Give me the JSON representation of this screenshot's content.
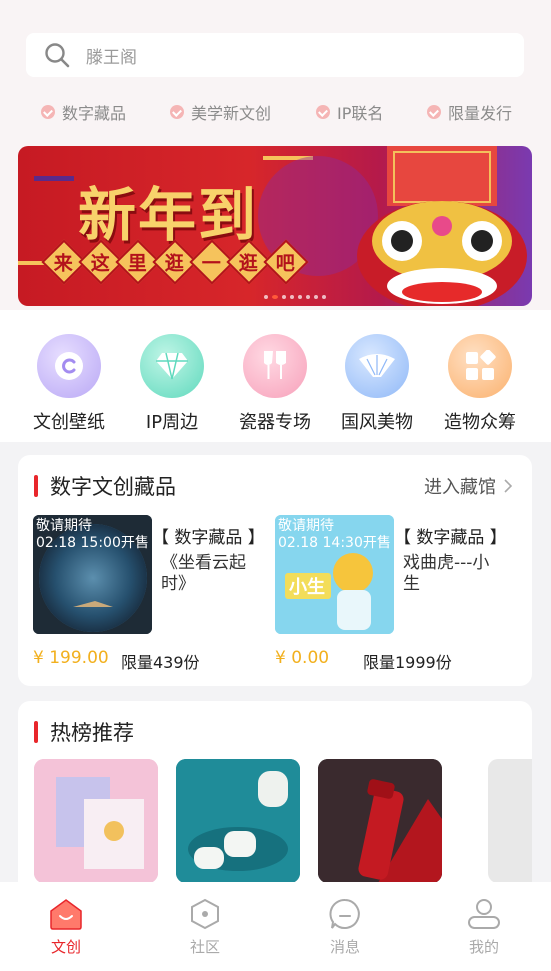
{
  "search": {
    "placeholder": "滕王阁"
  },
  "tags": [
    "数字藏品",
    "美学新文创",
    "IP联名",
    "限量发行"
  ],
  "banner": {
    "title": "新年到",
    "subtitle": [
      "来",
      "这",
      "里",
      "逛",
      "一",
      "逛",
      "吧"
    ],
    "slide_count": 8,
    "active_slide": 2
  },
  "categories": [
    {
      "label": "文创壁纸",
      "icon": "copyright-icon",
      "color": "#b9a8f5"
    },
    {
      "label": "IP周边",
      "icon": "diamond-icon",
      "color": "#5fd9bd"
    },
    {
      "label": "瓷器专场",
      "icon": "wine-glass-icon",
      "color": "#f7a0ba"
    },
    {
      "label": "国风美物",
      "icon": "fan-icon",
      "color": "#8fb8f7"
    },
    {
      "label": "造物众筹",
      "icon": "blocks-icon",
      "color": "#fbb16d"
    }
  ],
  "collection": {
    "title": "数字文创藏品",
    "more": "进入藏馆",
    "items": [
      {
        "badge1": "敬请期待",
        "badge2": "02.18 15:00开售",
        "tag": "【 数字藏品 】",
        "name": "《坐看云起时》",
        "price": "¥ 199.00",
        "limit": "限量439份"
      },
      {
        "badge1": "敬请期待",
        "badge2": "02.18 14:30开售",
        "tag": "【 数字藏品 】",
        "name": "戏曲虎---小生",
        "price": "¥ 0.00",
        "limit": "限量1999份"
      }
    ]
  },
  "hot": {
    "title": "热榜推荐"
  },
  "tabbar": [
    {
      "label": "文创",
      "icon": "home-icon",
      "active": true
    },
    {
      "label": "社区",
      "icon": "hexagon-icon",
      "active": false
    },
    {
      "label": "消息",
      "icon": "message-icon",
      "active": false
    },
    {
      "label": "我的",
      "icon": "user-icon",
      "active": false
    }
  ]
}
